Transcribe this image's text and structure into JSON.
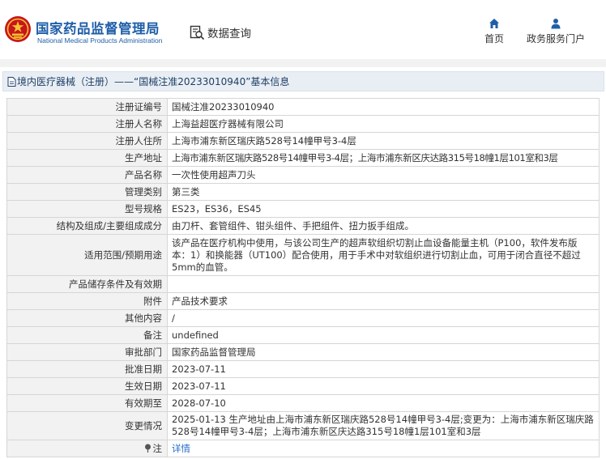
{
  "header": {
    "brand_cn": "国家药品监督管理局",
    "brand_en": "National Medical Products Administration",
    "query_label": "数据查询",
    "nav_home": "首页",
    "nav_portal": "政务服务门户",
    "brand_color": "#1f5fa8",
    "emblem_color": "#c8161d"
  },
  "title": {
    "text": "境内医疗器械（注册）——“国械注准20233010940”基本信息"
  },
  "rows": [
    {
      "label": "注册证编号",
      "value": "国械注准20233010940"
    },
    {
      "label": "注册人名称",
      "value": "上海益超医疗器械有限公司"
    },
    {
      "label": "注册人住所",
      "value": "上海市浦东新区瑞庆路528号14幢甲号3-4层"
    },
    {
      "label": "生产地址",
      "value": "上海市浦东新区瑞庆路528号14幢甲号3-4层；上海市浦东新区庆达路315号18幢1层101室和3层"
    },
    {
      "label": "产品名称",
      "value": "一次性使用超声刀头"
    },
    {
      "label": "管理类别",
      "value": "第三类"
    },
    {
      "label": "型号规格",
      "value": "ES23，ES36，ES45"
    },
    {
      "label": "结构及组成/主要组成成分",
      "value": "由刀杆、套管组件、钳头组件、手把组件、扭力扳手组成。"
    },
    {
      "label": "适用范围/预期用途",
      "value": "该产品在医疗机构中使用，与该公司生产的超声软组织切割止血设备能量主机（P100，软件发布版本：1）和换能器（UT100）配合使用，用于手术中对软组织进行切割止血，可用于闭合直径不超过5mm的血管。"
    },
    {
      "label": "产品储存条件及有效期",
      "value": ""
    },
    {
      "label": "附件",
      "value": "产品技术要求"
    },
    {
      "label": "其他内容",
      "value": "/"
    },
    {
      "label": "备注",
      "value": "undefined"
    },
    {
      "label": "审批部门",
      "value": "国家药品监督管理局"
    },
    {
      "label": "批准日期",
      "value": "2023-07-11"
    },
    {
      "label": "生效日期",
      "value": "2023-07-11"
    },
    {
      "label": "有效期至",
      "value": "2028-07-10"
    },
    {
      "label": "变更情况",
      "value": "2025-01-13 生产地址由上海市浦东新区瑞庆路528号14幢甲号3-4层;变更为：上海市浦东新区瑞庆路528号14幢甲号3-4层；上海市浦东新区庆达路315号18幢1层101室和3层"
    },
    {
      "label": "注",
      "value": "详情"
    }
  ]
}
